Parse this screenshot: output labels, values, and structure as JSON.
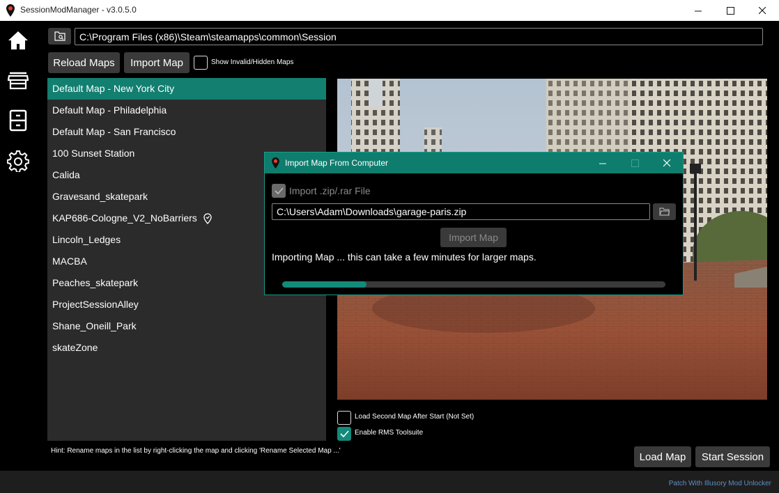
{
  "window": {
    "title": "SessionModManager - v3.0.5.0"
  },
  "nav": {
    "items": [
      "home-icon",
      "store-icon",
      "cabinet-icon",
      "gear-icon"
    ]
  },
  "toolbar": {
    "game_path": "C:\\Program Files (x86)\\Steam\\steamapps\\common\\Session",
    "reload_label": "Reload Maps",
    "import_label": "Import Map",
    "show_invalid_label": "Show Invalid/Hidden Maps",
    "show_invalid_checked": false
  },
  "maps": [
    "Default Map - New York City",
    "Default Map - Philadelphia",
    "Default Map - San Francisco",
    "100 Sunset Station",
    "Calida",
    "Gravesand_skatepark",
    "KAP686-Cologne_V2_NoBarriers",
    "Lincoln_Ledges",
    "MACBA",
    "Peaches_skatepark",
    "ProjectSessionAlley",
    "Shane_Oneill_Park",
    "skateZone"
  ],
  "selected_map": "Default Map - New York City",
  "options": {
    "second_map_label": "Load Second Map After Start (Not Set)",
    "second_map_checked": false,
    "rms_label": "Enable RMS Toolsuite",
    "rms_checked": true
  },
  "hint": "Hint: Rename maps in the list by right-clicking the map and clicking 'Rename Selected Map ...'",
  "actions": {
    "load_map": "Load Map",
    "start_session": "Start Session"
  },
  "footer": {
    "patch_link": "Patch With Illusory Mod Unlocker"
  },
  "dialog": {
    "title": "Import Map From Computer",
    "zip_label": "Import .zip/.rar File",
    "zip_checked": true,
    "file_path": "C:\\Users\\Adam\\Downloads\\garage-paris.zip",
    "import_label": "Import Map",
    "status": "Importing Map ... this can take a few minutes for larger maps.",
    "progress": 0.22
  },
  "colors": {
    "accent": "#127f70",
    "link": "#5d8fc5"
  }
}
